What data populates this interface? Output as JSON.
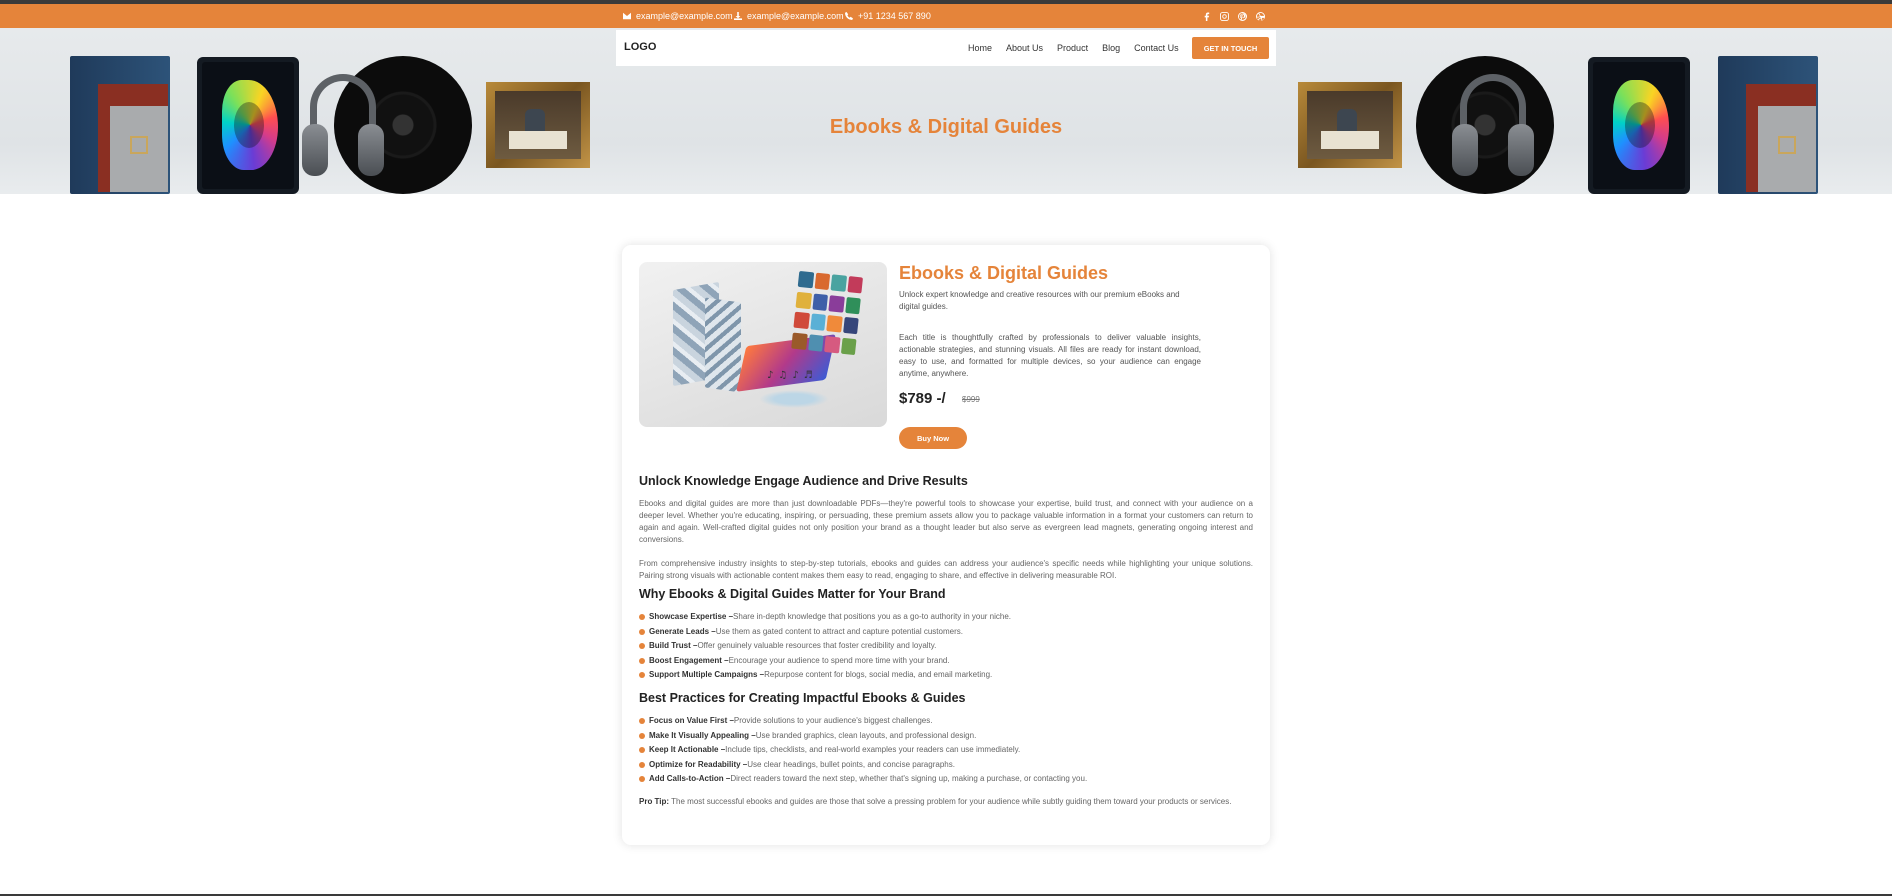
{
  "topbar": {
    "email1": "example@example.com",
    "email2": "example@example.com",
    "phone": "+91 1234 567 890",
    "socials": [
      "facebook-icon",
      "instagram-icon",
      "pinterest-icon",
      "dribbble-icon"
    ],
    "accent_color": "#e5843a"
  },
  "nav": {
    "logo": "LOGO",
    "links": [
      "Home",
      "About Us",
      "Product",
      "Blog",
      "Contact Us"
    ],
    "cta": "GET IN TOUCH"
  },
  "hero": {
    "title": "Ebooks & Digital Guides"
  },
  "product": {
    "title": "Ebooks & Digital Guides",
    "desc1": "Unlock expert knowledge and creative resources with our premium eBooks and digital guides.",
    "desc2": "Each title is thoughtfully crafted by professionals to deliver valuable insights, actionable strategies, and stunning visuals. All files are ready for instant download, easy to use, and formatted for multiple devices, so your audience can engage anytime, anywhere.",
    "price": "$789 -/",
    "old_price": "$999",
    "buy": "Buy Now"
  },
  "section1": {
    "heading": "Unlock Knowledge Engage Audience and Drive Results",
    "p1": "Ebooks and digital guides are more than just downloadable PDFs—they're powerful tools to showcase your expertise, build trust, and connect with your audience on a deeper level. Whether you're educating, inspiring, or persuading, these premium assets allow you to package valuable information in a format your customers can return to again and again. Well-crafted digital guides not only position your brand as a thought leader but also serve as evergreen lead magnets, generating ongoing interest and conversions.",
    "p2": "From comprehensive industry insights to step-by-step tutorials, ebooks and guides can address your audience's specific needs while highlighting your unique solutions. Pairing strong visuals with actionable content makes them easy to read, engaging to share, and effective in delivering measurable ROI."
  },
  "section2": {
    "heading": "Why Ebooks & Digital Guides Matter for Your Brand",
    "items": [
      {
        "bold": "Showcase Expertise –",
        "text": " Share in-depth knowledge that positions you as a go-to authority in your niche."
      },
      {
        "bold": "Generate Leads –",
        "text": " Use them as gated content to attract and capture potential customers."
      },
      {
        "bold": "Build Trust –",
        "text": " Offer genuinely valuable resources that foster credibility and loyalty."
      },
      {
        "bold": "Boost Engagement –",
        "text": " Encourage your audience to spend more time with your brand."
      },
      {
        "bold": "Support Multiple Campaigns –",
        "text": " Repurpose content for blogs, social media, and email marketing."
      }
    ]
  },
  "section3": {
    "heading": "Best Practices for Creating Impactful Ebooks & Guides",
    "items": [
      {
        "bold": "Focus on Value First –",
        "text": " Provide solutions to your audience's biggest challenges."
      },
      {
        "bold": "Make It Visually Appealing –",
        "text": " Use branded graphics, clean layouts, and professional design."
      },
      {
        "bold": "Keep It Actionable –",
        "text": " Include tips, checklists, and real-world examples your readers can use immediately."
      },
      {
        "bold": "Optimize for Readability –",
        "text": " Use clear headings, bullet points, and concise paragraphs."
      },
      {
        "bold": "Add Calls-to-Action –",
        "text": " Direct readers toward the next step, whether that's signing up, making a purchase, or contacting you."
      }
    ]
  },
  "protip": {
    "bold": "Pro Tip:",
    "text": " The most successful ebooks and guides are those that solve a pressing problem for your audience while subtly guiding them toward your products or services."
  }
}
